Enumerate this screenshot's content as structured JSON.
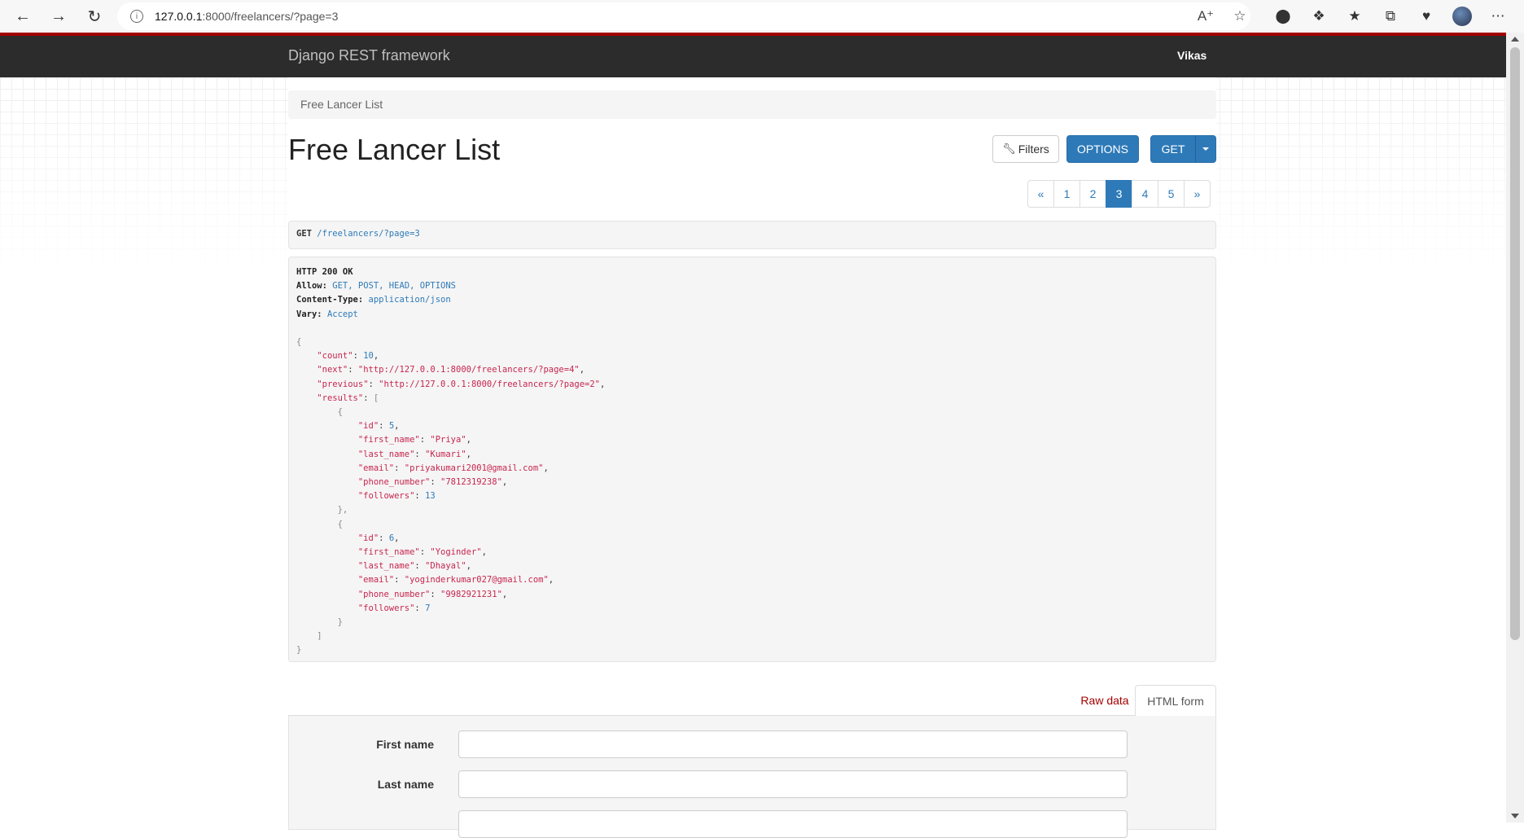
{
  "browser": {
    "url_host": "127.0.0.1",
    "url_path": ":8000/freelancers/?page=3"
  },
  "navbar": {
    "brand": "Django REST framework",
    "user": "Vikas"
  },
  "breadcrumb": "Free Lancer List",
  "page_title": "Free Lancer List",
  "buttons": {
    "filters": "Filters",
    "options": "OPTIONS",
    "get": "GET"
  },
  "pagination": {
    "items": [
      "«",
      "1",
      "2",
      "3",
      "4",
      "5",
      "»"
    ],
    "active": "3"
  },
  "request": {
    "method": "GET",
    "url": "/freelancers/?page=3"
  },
  "response": {
    "status": "HTTP 200 OK",
    "headers": [
      {
        "name": "Allow:",
        "value": "GET, POST, HEAD, OPTIONS"
      },
      {
        "name": "Content-Type:",
        "value": "application/json"
      },
      {
        "name": "Vary:",
        "value": "Accept"
      }
    ],
    "count": 10,
    "next": "\"http://127.0.0.1:8000/freelancers/?page=4\"",
    "previous": "\"http://127.0.0.1:8000/freelancers/?page=2\"",
    "results": [
      {
        "id": 5,
        "first_name": "\"Priya\"",
        "last_name": "\"Kumari\"",
        "email": "\"priyakumari2001@gmail.com\"",
        "phone_number": "\"7812319238\"",
        "followers": 13
      },
      {
        "id": 6,
        "first_name": "\"Yoginder\"",
        "last_name": "\"Dhayal\"",
        "email": "\"yoginderkumar027@gmail.com\"",
        "phone_number": "\"9982921231\"",
        "followers": 7
      }
    ]
  },
  "tabs": {
    "raw": "Raw data",
    "html": "HTML form"
  },
  "form": {
    "first_name_label": "First name",
    "last_name_label": "Last name"
  }
}
